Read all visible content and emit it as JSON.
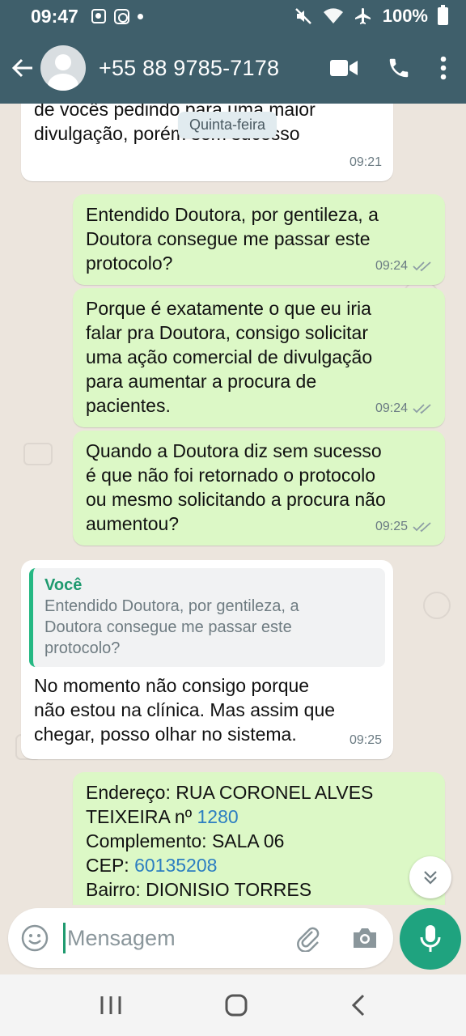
{
  "status_bar": {
    "time": "09:47",
    "battery": "100%"
  },
  "header": {
    "contact_name": "+55 88 9785-7178",
    "icons": [
      "back-arrow-icon",
      "avatar",
      "video-call-icon",
      "phone-icon",
      "more-options-icon"
    ]
  },
  "chat": {
    "date_chip": "Quinta-feira",
    "messages": [
      {
        "direction": "in",
        "text": "de vocês pedindo para uma maior\ndivulgação, porém sem sucesso",
        "time": "09:21"
      },
      {
        "direction": "out",
        "text": "Entendido Doutora, por gentileza, a\nDoutora consegue me passar este\nprotocolo?",
        "time": "09:24"
      },
      {
        "direction": "out",
        "text": "Porque é exatamente o que eu iria\nfalar pra Doutora, consigo solicitar\numa ação comercial de divulgação\npara aumentar a procura de\npacientes.",
        "time": "09:24"
      },
      {
        "direction": "out",
        "text": "Quando a Doutora diz sem sucesso\né que não foi retornado o protocolo\nou mesmo solicitando a procura não\naumentou?",
        "time": "09:25"
      },
      {
        "direction": "in",
        "quote_author": "Você",
        "quote_text": "Entendido Doutora, por gentileza, a\nDoutora consegue me passar este\nprotocolo?",
        "text": "No momento não consigo porque\nnão estou na clínica. Mas assim que\nchegar, posso olhar no sistema.",
        "time": "09:25"
      },
      {
        "direction": "out",
        "line1": "Endereço: RUA CORONEL ALVES",
        "line2_prefix": "TEIXEIRA nº ",
        "line2_link": "1280",
        "line3": "Complemento: SALA 06",
        "line4_prefix": "CEP: ",
        "line4_link": "60135208",
        "line5": "Bairro: DIONISIO TORRES"
      }
    ]
  },
  "input": {
    "placeholder": "Mensagem"
  },
  "colors": {
    "header": "#3f5f6b",
    "outgoing_bubble": "#dcf8c6",
    "incoming_bubble": "#ffffff",
    "accent": "#1fa37f",
    "chat_background": "#ece5dd"
  }
}
